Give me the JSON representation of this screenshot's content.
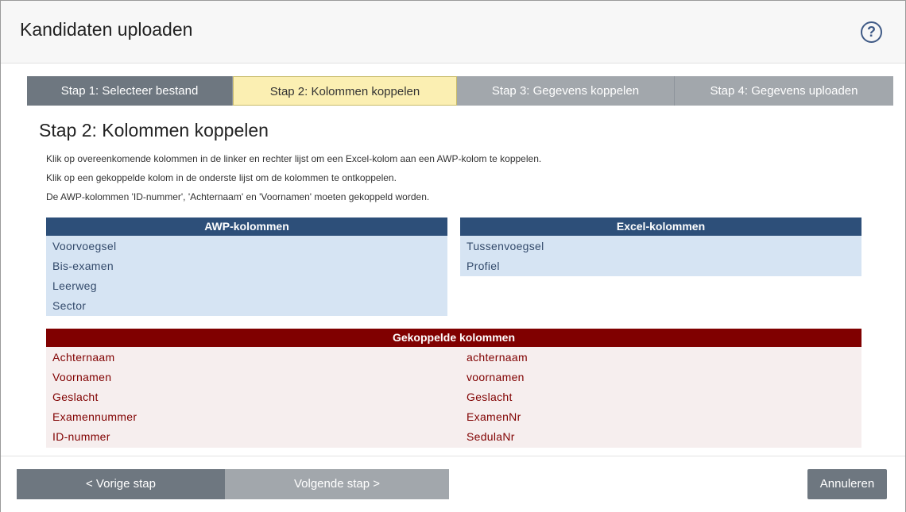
{
  "dialog": {
    "title": "Kandidaten uploaden",
    "help_icon": "?"
  },
  "steps": [
    {
      "label": "Stap 1: Selecteer bestand"
    },
    {
      "label": "Stap 2: Kolommen koppelen"
    },
    {
      "label": "Stap 3: Gegevens koppelen"
    },
    {
      "label": "Stap 4: Gegevens uploaden"
    }
  ],
  "main": {
    "title": "Stap 2: Kolommen koppelen",
    "instructions": [
      "Klik op overeenkomende kolommen in de linker en rechter lijst om een Excel-kolom aan een AWP-kolom te koppelen.",
      "Klik op een gekoppelde kolom in de onderste lijst om de kolommen te ontkoppelen.",
      "De AWP-kolommen 'ID-nummer', 'Achternaam' en 'Voornamen' moeten gekoppeld worden."
    ]
  },
  "awp": {
    "header": "AWP-kolommen",
    "items": [
      "Voorvoegsel",
      "Bis-examen",
      "Leerweg",
      "Sector"
    ]
  },
  "excel": {
    "header": "Excel-kolommen",
    "items": [
      "Tussenvoegsel",
      "Profiel"
    ]
  },
  "linked": {
    "header": "Gekoppelde kolommen",
    "rows": [
      {
        "awp": "Achternaam",
        "excel": "achternaam"
      },
      {
        "awp": "Voornamen",
        "excel": "voornamen"
      },
      {
        "awp": "Geslacht",
        "excel": "Geslacht"
      },
      {
        "awp": "Examennummer",
        "excel": "ExamenNr"
      },
      {
        "awp": "ID-nummer",
        "excel": "SedulaNr"
      }
    ]
  },
  "footer": {
    "prev_label": "< Vorige stap",
    "next_label": "Volgende stap >",
    "cancel_label": "Annuleren"
  },
  "colors": {
    "awp_header": "#2d4f79",
    "list_bg": "#d6e4f3",
    "linked_header": "#800000",
    "active_step": "#fbefb2"
  }
}
